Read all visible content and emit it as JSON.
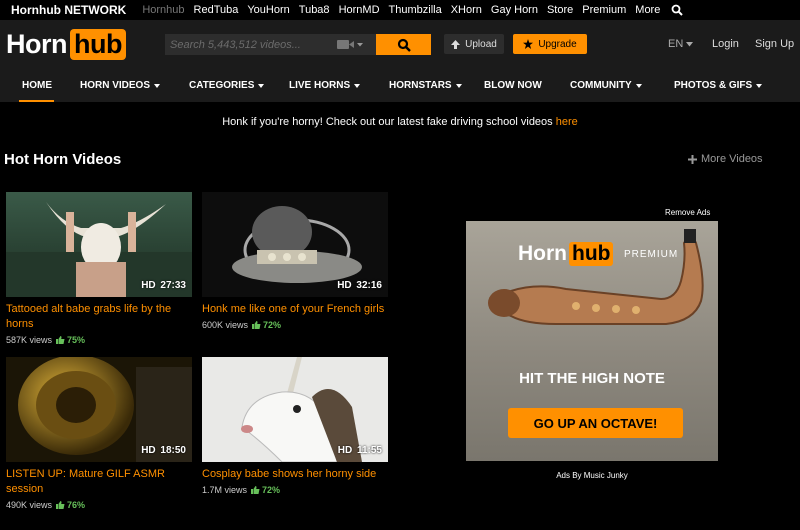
{
  "network": {
    "brand": "Hornhub NETWORK",
    "links": [
      {
        "label": "Hornhub",
        "dim": true
      },
      {
        "label": "RedTuba",
        "dim": false
      },
      {
        "label": "YouHorn",
        "dim": false
      },
      {
        "label": "Tuba8",
        "dim": false
      },
      {
        "label": "HornMD",
        "dim": false
      },
      {
        "label": "Thumbzilla",
        "dim": false
      },
      {
        "label": "XHorn",
        "dim": false
      },
      {
        "label": "Gay Horn",
        "dim": false
      },
      {
        "label": "Store",
        "dim": false
      },
      {
        "label": "Premium",
        "dim": false
      },
      {
        "label": "More",
        "dim": false
      }
    ],
    "search_icon": "search-icon"
  },
  "header": {
    "logo_left": "Horn",
    "logo_right": "hub",
    "search_placeholder": "Search 5,443,512 videos...",
    "upload_label": "Upload",
    "upgrade_label": "Upgrade",
    "lang": "EN",
    "login": "Login",
    "signup": "Sign Up"
  },
  "nav": {
    "items": [
      {
        "label": "HOME",
        "caret": false
      },
      {
        "label": "HORN VIDEOS",
        "caret": true
      },
      {
        "label": "CATEGORIES",
        "caret": true
      },
      {
        "label": "LIVE HORNS",
        "caret": true
      },
      {
        "label": "HORNSTARS",
        "caret": true
      },
      {
        "label": "BLOW NOW",
        "caret": false
      },
      {
        "label": "COMMUNITY",
        "caret": true
      },
      {
        "label": "PHOTOS & GIFS",
        "caret": true
      }
    ]
  },
  "announce": {
    "text": "Honk if you're horny! Check out our latest fake driving school videos ",
    "link": "here"
  },
  "section": {
    "title": "Hot Horn Videos",
    "more": "More Videos"
  },
  "videos": [
    {
      "hd": "HD",
      "duration": "27:33",
      "title": "Tattooed alt babe grabs life by the horns",
      "views": "587K views",
      "rating": "75%"
    },
    {
      "hd": "HD",
      "duration": "32:16",
      "title": "Honk me like one of your French girls",
      "views": "600K views",
      "rating": "72%"
    },
    {
      "hd": "HD",
      "duration": "18:50",
      "title": "LISTEN UP: Mature GILF ASMR session",
      "views": "490K views",
      "rating": "76%"
    },
    {
      "hd": "HD",
      "duration": "11:55",
      "title": "Cosplay babe shows her horny side",
      "views": "1.7M views",
      "rating": "72%"
    }
  ],
  "ad": {
    "remove": "Remove Ads",
    "logo_left": "Horn",
    "logo_right": "hub",
    "premium": "PREMIUM",
    "headline": "HIT THE HIGH NOTE",
    "cta": "GO UP AN OCTAVE!",
    "credit": "Ads By Music Junky"
  },
  "colors": {
    "accent": "#ff9000",
    "bar": "#1b1b1b",
    "rating": "#67c05a"
  }
}
